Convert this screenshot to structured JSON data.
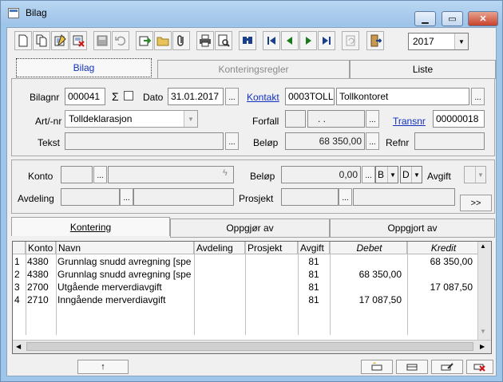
{
  "window": {
    "title": "Bilag"
  },
  "toolbar": {
    "year": "2017"
  },
  "tabs_top": [
    "Bilag",
    "Konteringsregler",
    "Liste"
  ],
  "form": {
    "bilagnr_label": "Bilagnr",
    "bilagnr": "000041",
    "sigma": "Σ",
    "dato_label": "Dato",
    "dato": "31.01.2017",
    "kontakt_label": "Kontakt",
    "kontakt_code": "0003TOLL",
    "kontakt_name": "Tollkontoret",
    "artnr_label": "Art/-nr",
    "artnr": "Tolldeklarasjon",
    "forfall_label": "Forfall",
    "forfall": ". .",
    "transnr_label": "Transnr",
    "transnr": "00000018",
    "tekst_label": "Tekst",
    "tekst": "",
    "belop_label": "Beløp",
    "belop": "68 350,00",
    "refnr_label": "Refnr",
    "refnr": ""
  },
  "line_edit": {
    "konto_label": "Konto",
    "belop_label": "Beløp",
    "belop": "0,00",
    "b_value": "B",
    "d_value": "D",
    "avgift_label": "Avgift",
    "avdeling_label": "Avdeling",
    "prosjekt_label": "Prosjekt",
    "more_button": ">>"
  },
  "tabs_bottom": [
    "Kontering",
    "Oppgjør av",
    "Oppgjort av"
  ],
  "grid": {
    "columns": [
      "Konto",
      "Navn",
      "Avdeling",
      "Prosjekt",
      "Avgift",
      "Debet",
      "Kredit"
    ],
    "rows": [
      {
        "n": "1",
        "konto": "4380",
        "navn": "Grunnlag snudd avregning [spe",
        "avdeling": "",
        "prosjekt": "",
        "avgift": "81",
        "debet": "",
        "kredit": "68 350,00"
      },
      {
        "n": "2",
        "konto": "4380",
        "navn": "Grunnlag snudd avregning [spe",
        "avdeling": "",
        "prosjekt": "",
        "avgift": "81",
        "debet": "68 350,00",
        "kredit": ""
      },
      {
        "n": "3",
        "konto": "2700",
        "navn": "Utgående merverdiavgift",
        "avdeling": "",
        "prosjekt": "",
        "avgift": "81",
        "debet": "",
        "kredit": "17 087,50"
      },
      {
        "n": "4",
        "konto": "2710",
        "navn": "Inngående merverdiavgift",
        "avdeling": "",
        "prosjekt": "",
        "avgift": "81",
        "debet": "17 087,50",
        "kredit": ""
      }
    ]
  },
  "bottom": {
    "up_arrow": "↑"
  }
}
